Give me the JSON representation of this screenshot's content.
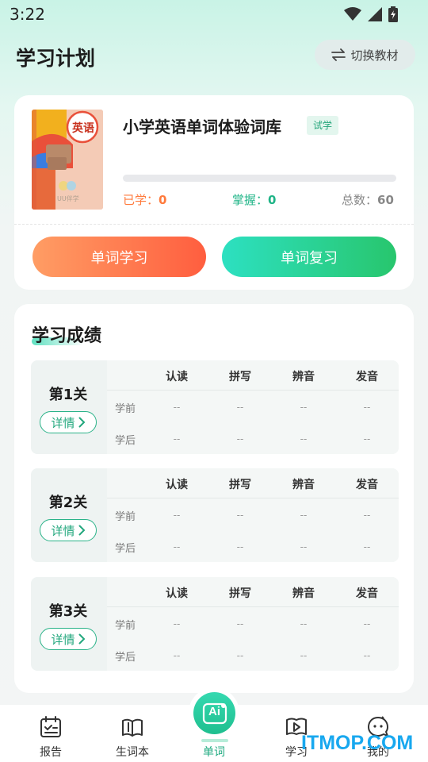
{
  "status_bar": {
    "time": "3:22"
  },
  "header": {
    "title": "学习计划",
    "switch_label": "切换教材"
  },
  "book": {
    "cover_title": "英语",
    "cover_brand": "UU伴学",
    "name": "小学英语单词体验词库",
    "badge": "试学",
    "progress_fraction": 0.0,
    "learned_label": "已学：",
    "learned_value": "0",
    "mastered_label": "掌握：",
    "mastered_value": "0",
    "total_label": "总数：",
    "total_value": "60",
    "learn_button": "单词学习",
    "review_button": "单词复习",
    "colors": {
      "learned": "#ff7a3c",
      "mastered": "#1fb487",
      "total": "#888888"
    }
  },
  "results": {
    "title": "学习成绩",
    "columns": [
      "认读",
      "拼写",
      "辨音",
      "发音"
    ],
    "row_labels": [
      "学前",
      "学后"
    ],
    "detail_label": "详情",
    "levels": [
      {
        "name": "第1关",
        "before": [
          "--",
          "--",
          "--",
          "--"
        ],
        "after": [
          "--",
          "--",
          "--",
          "--"
        ]
      },
      {
        "name": "第2关",
        "before": [
          "--",
          "--",
          "--",
          "--"
        ],
        "after": [
          "--",
          "--",
          "--",
          "--"
        ]
      },
      {
        "name": "第3关",
        "before": [
          "--",
          "--",
          "--",
          "--"
        ],
        "after": [
          "--",
          "--",
          "--",
          "--"
        ]
      }
    ]
  },
  "nav": {
    "items": [
      {
        "label": "报告",
        "icon": "report-icon"
      },
      {
        "label": "生词本",
        "icon": "book-icon"
      },
      {
        "label": "单词",
        "icon": "ai-icon"
      },
      {
        "label": "学习",
        "icon": "play-book-icon"
      },
      {
        "label": "我的",
        "icon": "profile-icon"
      }
    ],
    "center_text": "Ai",
    "active": "单词"
  },
  "watermark": "ITMOP.COM"
}
